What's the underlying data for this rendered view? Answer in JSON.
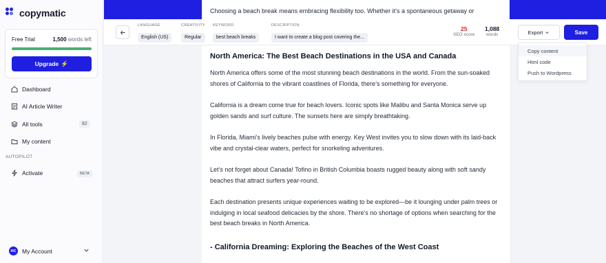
{
  "app": {
    "name": "copymatic"
  },
  "sidebar": {
    "plan": {
      "name": "Free Trial",
      "words_count": "1,500",
      "words_suffix": "words left",
      "progress": 1.0,
      "upgrade_label": "Upgrade"
    },
    "items": [
      {
        "label": "Dashboard",
        "icon": "home-icon"
      },
      {
        "label": "AI Article Writer",
        "icon": "article-icon"
      },
      {
        "label": "All tools",
        "icon": "layers-icon",
        "badge": "82"
      },
      {
        "label": "My content",
        "icon": "folder-icon"
      }
    ],
    "autopilot_label": "AUTOPILOT",
    "activate": {
      "label": "Activate",
      "badge": "BETA"
    },
    "account": {
      "initials": "HC",
      "label": "My Account"
    }
  },
  "toolbar": {
    "language": {
      "label": "LANGUAGE",
      "value": "English (US)"
    },
    "creativity": {
      "label": "CREATIVITY",
      "value": "Regular"
    },
    "keyword": {
      "label": "KEYWORD",
      "value": "best beach breaks"
    },
    "description": {
      "label": "DESCRIPTION",
      "value": "I want to create a blog post covering the..."
    },
    "seo": {
      "value": "25",
      "label": "SEO score"
    },
    "words": {
      "value": "1,088",
      "label": "words"
    },
    "export_label": "Export",
    "save_label": "Save"
  },
  "export_menu": [
    "Copy content",
    "Html code",
    "Push to Wordpress"
  ],
  "document": {
    "top_line": "Choosing a beach break means embracing flexibility too. Whether it’s a spontaneous getaway or",
    "heading1": "North America: The Best Beach Destinations in the USA and Canada",
    "p1": "North America offers some of the most stunning beach destinations in the world. From the sun-soaked shores of California to the vibrant coastlines of Florida, there’s something for everyone.",
    "p2": "California is a dream come true for beach lovers. Iconic spots like Malibu and Santa Monica serve up golden sands and surf culture. The sunsets here are simply breathtaking.",
    "p3": "In Florida, Miami’s lively beaches pulse with energy. Key West invites you to slow down with its laid-back vibe and crystal-clear waters, perfect for snorkeling adventures.",
    "p4": "Let’s not forget about Canada! Tofino in British Columbia boasts rugged beauty along with soft sandy beaches that attract surfers year-round.",
    "p5": "Each destination presents unique experiences waiting to be explored—be it lounging under palm trees or indulging in local seafood delicacies by the shore. There’s no shortage of options when searching for the best beach breaks in North America.",
    "heading2": "- California Dreaming: Exploring the Beaches of the West Coast"
  },
  "colors": {
    "brand": "#1e1fe0",
    "progress": "#4caf73",
    "seo_score": "#e11d2e"
  }
}
